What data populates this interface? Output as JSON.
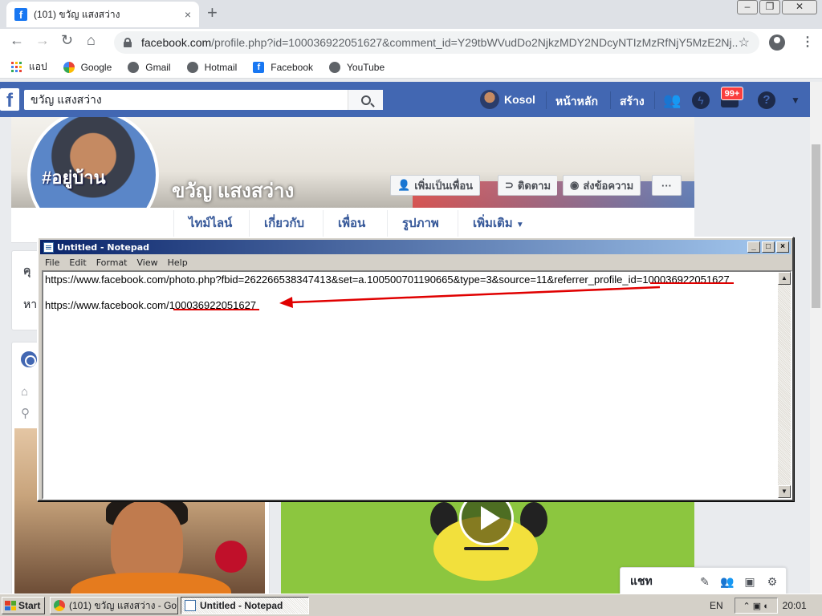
{
  "browser": {
    "tab_title": "(101) ขวัญ แสงสว่าง",
    "tab_close": "×",
    "new_tab": "+",
    "url_domain": "facebook.com",
    "url_rest": "/profile.php?id=100036922051627&comment_id=Y29tbWVudDo2NjkzMDY2NDcyNTIzMzRfNjY5MzE2Nj...",
    "bookmarks": [
      "แอป",
      "Google",
      "Gmail",
      "Hotmail",
      "Facebook",
      "YouTube"
    ]
  },
  "facebook": {
    "search_value": "ขวัญ แสงสว่าง",
    "user_name": "Kosol",
    "nav": [
      "หน้าหลัก",
      "สร้าง"
    ],
    "notification_count": "99+",
    "profile_name": "ขวัญ แสงสว่าง",
    "profile_pic_text": "#อยู่บ้าน",
    "buttons": {
      "add_friend": "เพิ่มเป็นเพื่อน",
      "follow": "ติดตาม",
      "message": "ส่งข้อความ",
      "more": "···"
    },
    "tabs": [
      "ไทม์ไลน์",
      "เกี่ยวกับ",
      "เพื่อน",
      "รูปภาพ",
      "เพิ่มเติม"
    ],
    "intro_title": "คุ",
    "intro_text": "หา",
    "chat_label": "แชท"
  },
  "notepad": {
    "title": "Untitled - Notepad",
    "menu": [
      "File",
      "Edit",
      "Format",
      "View",
      "Help"
    ],
    "line1_prefix": "https://www.facebook.com/photo.php?fbid=262266538347413&set=a.100500701190665&type=3&source=11&referrer_profile_id=",
    "line1_id": "100036922051627",
    "line2_prefix": "https://www.facebook.com/",
    "line2_id": "100036922051627"
  },
  "taskbar": {
    "start": "Start",
    "tasks": [
      "(101) ขวัญ แสงสว่าง - Go...",
      "Untitled - Notepad"
    ],
    "lang": "EN",
    "time": "20:01"
  },
  "colors": {
    "facebook_blue": "#4267b2",
    "annotation_red": "#e00000"
  }
}
